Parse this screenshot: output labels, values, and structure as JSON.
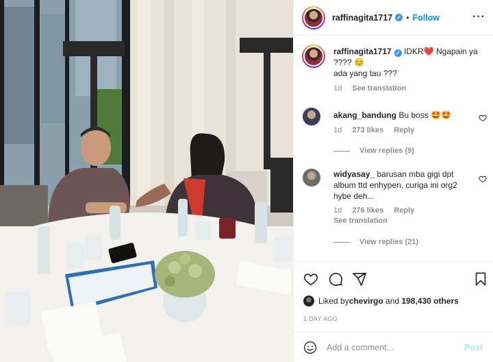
{
  "post": {
    "username": "raffinagita1717",
    "follow_label": "Follow",
    "separator": "•",
    "more_label": "···"
  },
  "caption": {
    "username": "raffinagita1717",
    "text_line1": " IDKR❤️ Ngapain ya ???? 😊",
    "text_line2": "ada yang tau ???",
    "time": "1d",
    "see_translation": "See translation"
  },
  "comments": [
    {
      "username": "akang_bandung",
      "text": " Bu boss 🤩🤩",
      "time": "1d",
      "likes": "273 likes",
      "reply": "Reply",
      "view_replies": "View replies (9)"
    },
    {
      "username": "widyasay_",
      "text": " barusan mba gigi dpt album ttd enhypen, curiga ini org2 hybe deh...",
      "time": "1d",
      "likes": "276 likes",
      "reply": "Reply",
      "see_translation": "See translation",
      "view_replies": "View replies (21)"
    }
  ],
  "likes": {
    "prefix": "Liked by ",
    "user": "chevirgo",
    "middle": " and ",
    "count": "198,430 others"
  },
  "date": "1 DAY AGO",
  "add_comment": {
    "placeholder": "Add a comment...",
    "post_label": "Post"
  },
  "icons": {
    "heart": "heart-icon",
    "comment": "comment-icon",
    "share": "share-icon",
    "save": "bookmark-icon",
    "emoji": "emoji-icon",
    "verified": "verified-badge-icon"
  },
  "colors": {
    "accent": "#0095f6",
    "muted": "#8e8e8e",
    "post_disabled": "#b2dffc"
  }
}
